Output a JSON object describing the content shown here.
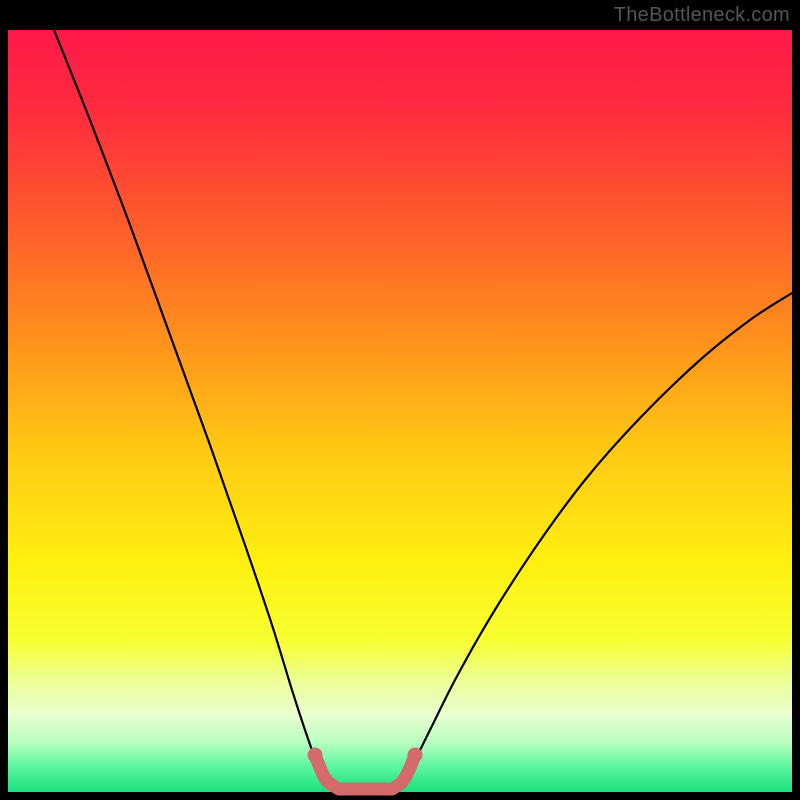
{
  "watermark": "TheBottleneck.com",
  "chart_data": {
    "type": "line",
    "title": "",
    "xlabel": "",
    "ylabel": "",
    "xlim": [
      8,
      792
    ],
    "ylim": [
      30,
      792
    ],
    "background_gradient": {
      "stops": [
        {
          "offset": 0.0,
          "color": "#ff1a4a"
        },
        {
          "offset": 0.1,
          "color": "#ff2a3f"
        },
        {
          "offset": 0.25,
          "color": "#ff5a2c"
        },
        {
          "offset": 0.4,
          "color": "#ff8f1c"
        },
        {
          "offset": 0.55,
          "color": "#ffc814"
        },
        {
          "offset": 0.7,
          "color": "#fff010"
        },
        {
          "offset": 0.8,
          "color": "#f7ff30"
        },
        {
          "offset": 0.86,
          "color": "#ecffa0"
        },
        {
          "offset": 0.9,
          "color": "#e7ffd0"
        },
        {
          "offset": 0.935,
          "color": "#b8ffc0"
        },
        {
          "offset": 0.965,
          "color": "#60f7a0"
        },
        {
          "offset": 1.0,
          "color": "#18e07e"
        }
      ]
    },
    "series": [
      {
        "name": "bottleneck-curve-left",
        "stroke": "#000000",
        "stroke_width": 2.2,
        "points": [
          {
            "x": 54,
            "y": 30
          },
          {
            "x": 90,
            "y": 120
          },
          {
            "x": 130,
            "y": 225
          },
          {
            "x": 170,
            "y": 335
          },
          {
            "x": 210,
            "y": 445
          },
          {
            "x": 245,
            "y": 545
          },
          {
            "x": 272,
            "y": 625
          },
          {
            "x": 292,
            "y": 690
          },
          {
            "x": 305,
            "y": 730
          },
          {
            "x": 315,
            "y": 758
          },
          {
            "x": 323,
            "y": 775
          }
        ]
      },
      {
        "name": "bottleneck-curve-right",
        "stroke": "#000000",
        "stroke_width": 2.2,
        "points": [
          {
            "x": 406,
            "y": 775
          },
          {
            "x": 415,
            "y": 760
          },
          {
            "x": 430,
            "y": 730
          },
          {
            "x": 455,
            "y": 680
          },
          {
            "x": 490,
            "y": 618
          },
          {
            "x": 535,
            "y": 548
          },
          {
            "x": 585,
            "y": 480
          },
          {
            "x": 640,
            "y": 418
          },
          {
            "x": 700,
            "y": 360
          },
          {
            "x": 750,
            "y": 320
          },
          {
            "x": 792,
            "y": 293
          }
        ]
      },
      {
        "name": "pink-cap-left",
        "stroke": "#d46a6a",
        "stroke_width": 13,
        "points": [
          {
            "x": 315,
            "y": 755
          },
          {
            "x": 321,
            "y": 770
          },
          {
            "x": 327,
            "y": 781
          },
          {
            "x": 339,
            "y": 789
          }
        ]
      },
      {
        "name": "pink-valley-flat",
        "stroke": "#d46a6a",
        "stroke_width": 13,
        "points": [
          {
            "x": 339,
            "y": 789
          },
          {
            "x": 392,
            "y": 789
          }
        ]
      },
      {
        "name": "pink-cap-right",
        "stroke": "#d46a6a",
        "stroke_width": 13,
        "points": [
          {
            "x": 392,
            "y": 789
          },
          {
            "x": 402,
            "y": 782
          },
          {
            "x": 409,
            "y": 770
          },
          {
            "x": 415,
            "y": 755
          }
        ]
      }
    ],
    "highlight_dots": {
      "fill": "#d46a6a",
      "radius": 7.5,
      "points": [
        {
          "x": 315,
          "y": 755
        },
        {
          "x": 415,
          "y": 755
        }
      ]
    },
    "green_band": {
      "y_top": 773,
      "y_bottom": 792
    }
  }
}
